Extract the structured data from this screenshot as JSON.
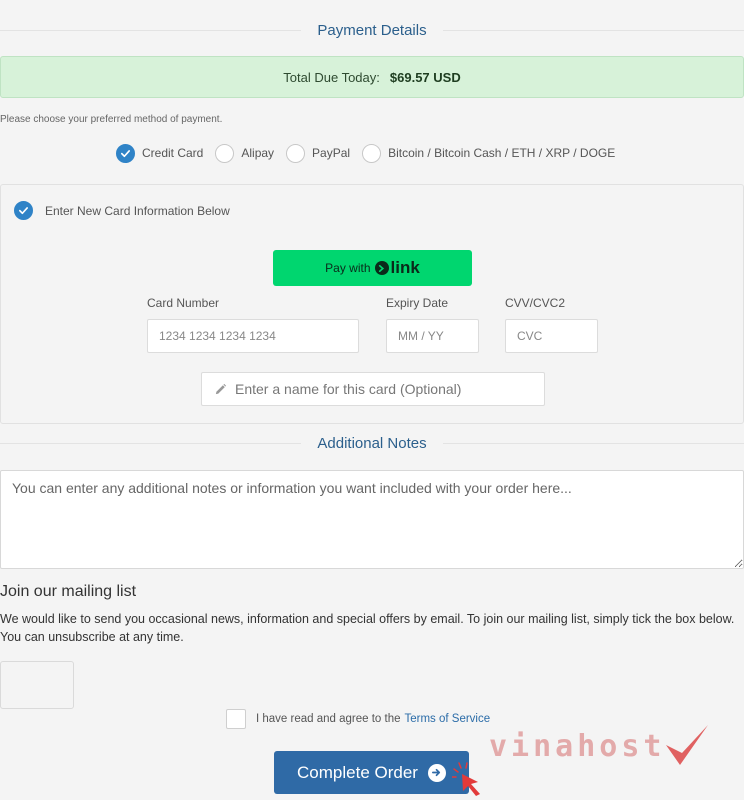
{
  "payment_section": {
    "title": "Payment Details"
  },
  "total": {
    "label": "Total Due Today:",
    "amount": "$69.57 USD"
  },
  "payment_method": {
    "prompt": "Please choose your preferred method of payment.",
    "options": [
      "Credit Card",
      "Alipay",
      "PayPal",
      "Bitcoin / Bitcoin Cash / ETH / XRP / DOGE"
    ],
    "selected": "Credit Card"
  },
  "card": {
    "new_card_label": "Enter New Card Information Below",
    "pay_with_link": {
      "prefix": "Pay with",
      "brand": "link"
    },
    "number": {
      "label": "Card Number",
      "placeholder": "1234 1234 1234 1234"
    },
    "expiry": {
      "label": "Expiry Date",
      "placeholder": "MM / YY"
    },
    "cvc": {
      "label": "CVV/CVC2",
      "placeholder": "CVC"
    },
    "name": {
      "placeholder": "Enter a name for this card (Optional)"
    }
  },
  "notes_section": {
    "title": "Additional Notes",
    "placeholder": "You can enter any additional notes or information you want included with your order here..."
  },
  "mailing": {
    "title": "Join our mailing list",
    "text": "We would like to send you occasional news, information and special offers by email. To join our mailing list, simply tick the box below. You can unsubscribe at any time."
  },
  "tos": {
    "text": "I have read and agree to the",
    "link": "Terms of Service"
  },
  "complete_button": {
    "label": "Complete Order"
  },
  "watermark": {
    "text": "vinahost"
  },
  "colors": {
    "accent": "#2f83c7",
    "button": "#2f6aa6",
    "success_bg": "#d7f2d9",
    "link_green": "#00d66f",
    "heading": "#2b5f8c"
  },
  "icons": {
    "radio_checked": "check-icon",
    "name_field": "pencil-icon",
    "submit": "arrow-right-circle-icon",
    "pointer": "cursor-arrow-icon"
  }
}
